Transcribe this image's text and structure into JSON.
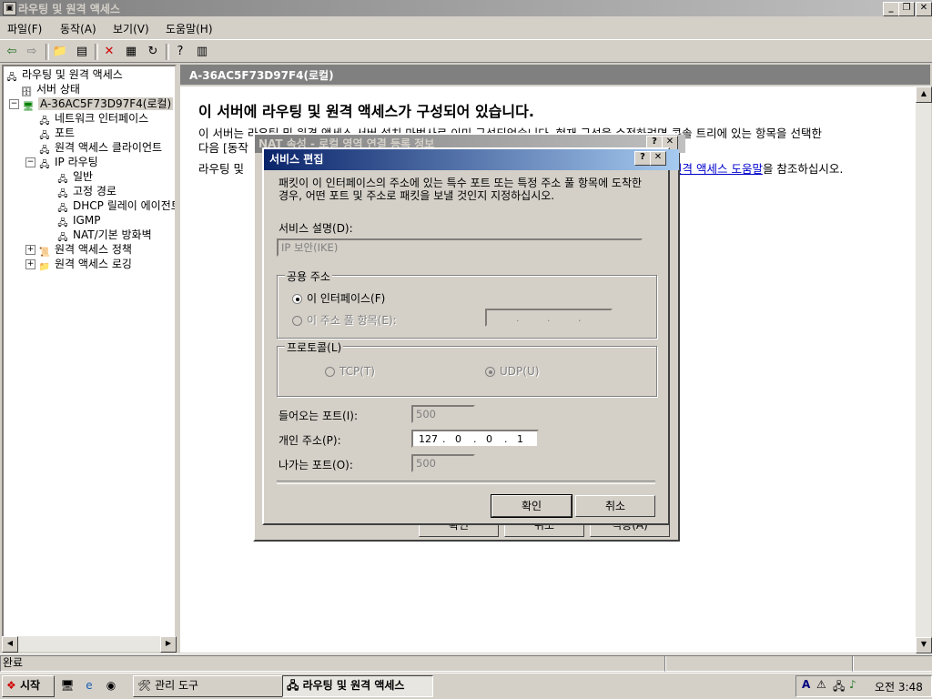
{
  "window": {
    "title": "라우팅 및 원격 액세스"
  },
  "menu": [
    "파일(F)",
    "동작(A)",
    "보기(V)",
    "도움말(H)"
  ],
  "tree": {
    "root": "라우팅 및 원격 액세스",
    "server_status": "서버 상태",
    "server": "A-36AC5F73D97F4(로컬)",
    "items": [
      "네트워크 인터페이스",
      "포트",
      "원격 액세스 클라이언트"
    ],
    "ip_routing": "IP 라우팅",
    "ip_children": [
      "일반",
      "고정 경로",
      "DHCP 릴레이 에이전트",
      "IGMP",
      "NAT/기본 방화벽"
    ],
    "policy": "원격 액세스 정책",
    "logging": "원격 액세스 로깅"
  },
  "right": {
    "header": "A-36AC5F73D97F4(로컬)",
    "heading": "이 서버에 라우팅 및 원격 액세스가 구성되어 있습니다.",
    "line1": "이 서버는 라우팅 및 원격 액세스 서버 설치 마법사로 이미 구성되었습니다. 현재 구성을 수정하려면 콘솔 트리에 있는 항목을 선택한",
    "line2": "다음 [동작",
    "line3_pre": "라우팅 및",
    "line3_link": "원격 액세스 도움말",
    "line3_post": "을 참조하십시오."
  },
  "status": {
    "text": "완료"
  },
  "taskbar": {
    "start": "시작",
    "tasks": [
      "관리 도구",
      "라우팅 및 원격 액세스"
    ],
    "clock": "오전 3:48"
  },
  "nat_dialog": {
    "title": "NAT 속성 - 로컬 영역 연결 등록 정보",
    "buttons": [
      "확인",
      "취소",
      "적용(A)"
    ]
  },
  "service_dialog": {
    "title": "서비스 편집",
    "description": "패킷이 이 인터페이스의 주소에 있는 특수 포트 또는 특정 주소 풀 항목에 도착한 경우, 어떤 포트 및 주소로 패킷을 보낼 것인지 지정하십시오.",
    "service_label": "서비스 설명(D):",
    "service_value": "IP 보안(IKE)",
    "public_group": "공용 주소",
    "radio_this_interface": "이 인터페이스(F)",
    "radio_pool": "이 주소 풀 항목(E):",
    "protocol_group": "프로토콜(L)",
    "radio_tcp": "TCP(T)",
    "radio_udp": "UDP(U)",
    "incoming_label": "들어오는 포트(I):",
    "incoming_value": "500",
    "private_label": "개인 주소(P):",
    "private_ip": [
      "127",
      "0",
      "0",
      "1"
    ],
    "outgoing_label": "나가는 포트(O):",
    "outgoing_value": "500",
    "ok": "확인",
    "cancel": "취소"
  }
}
